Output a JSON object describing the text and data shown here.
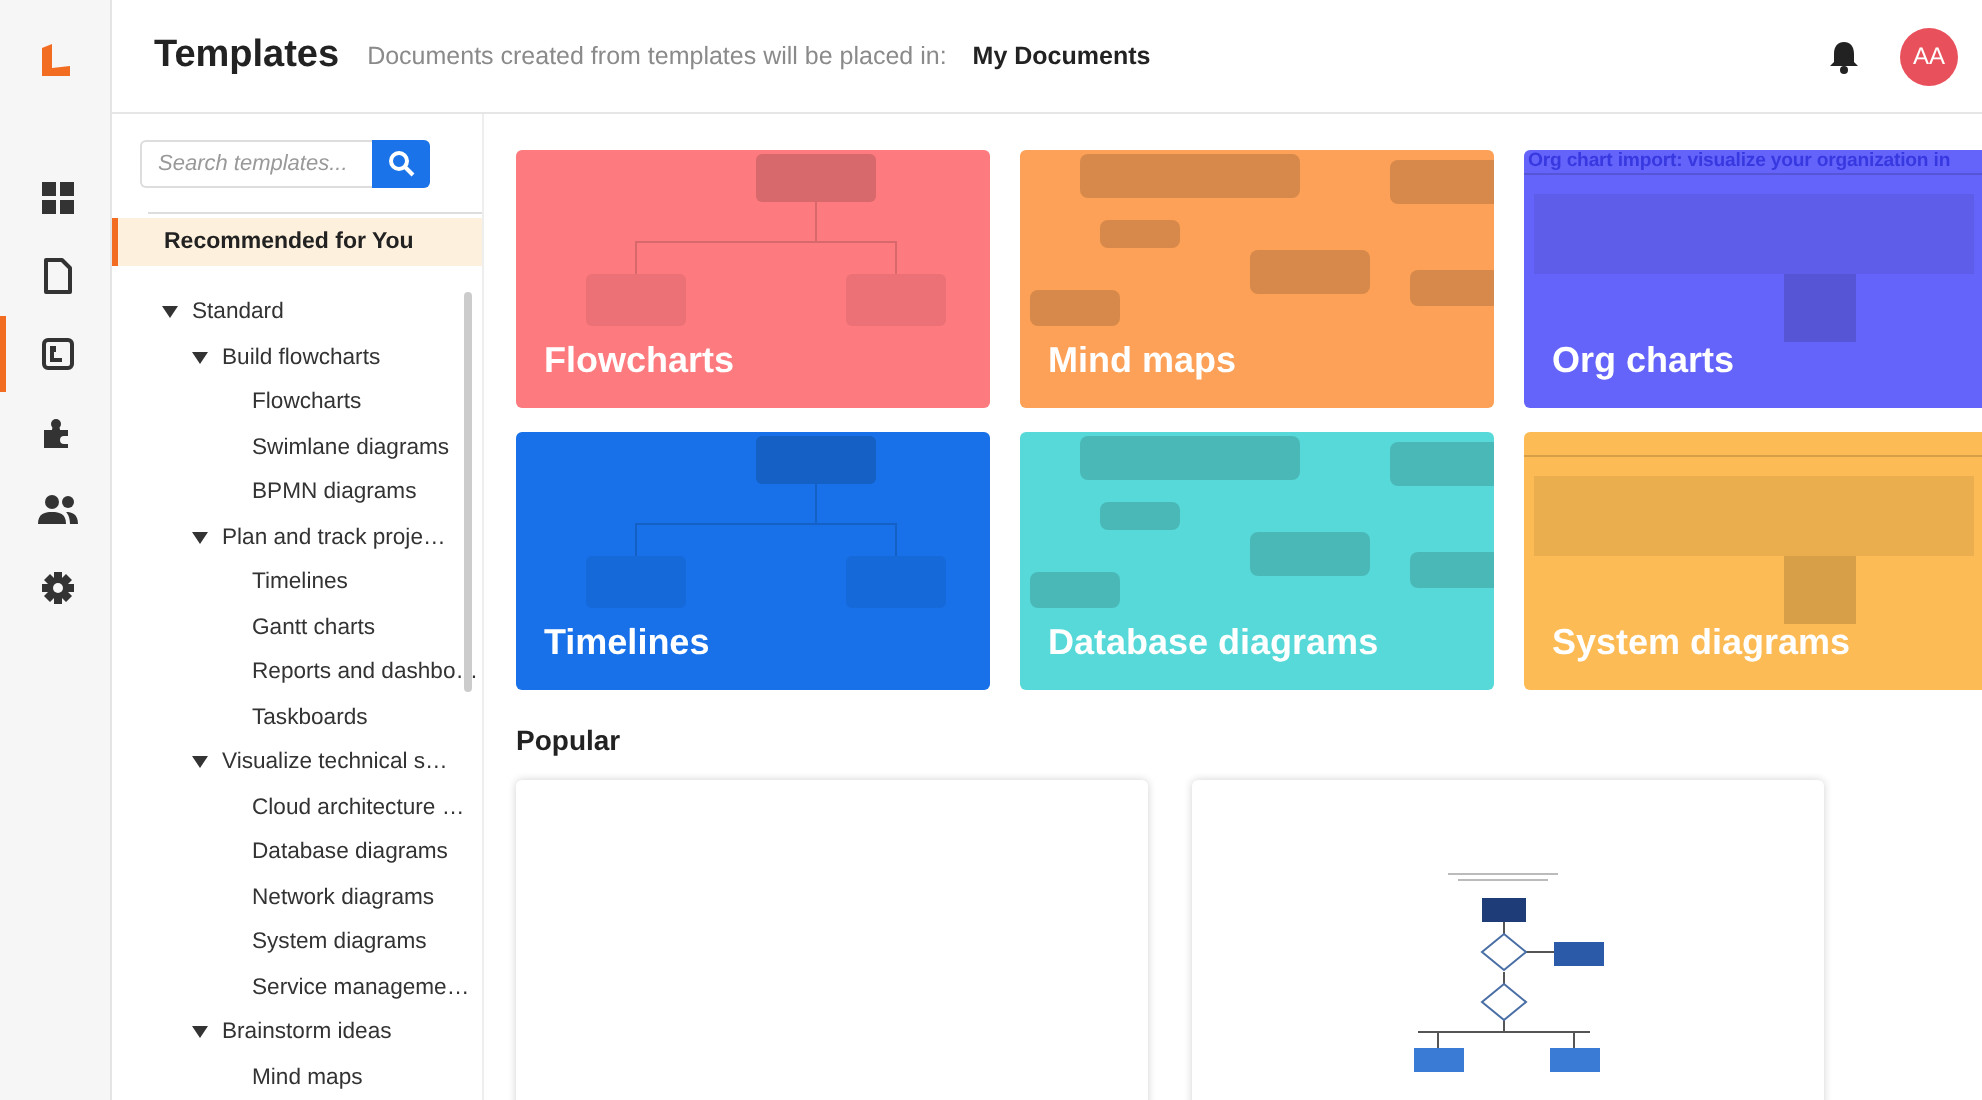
{
  "rail": {
    "items": [
      {
        "selected": false
      },
      {
        "selected": false
      },
      {
        "selected": true
      },
      {
        "selected": false
      },
      {
        "selected": false
      },
      {
        "selected": false
      }
    ]
  },
  "header": {
    "title": "Templates",
    "note": "Documents created from templates will be placed in:",
    "location": "My Documents",
    "avatar": "AA"
  },
  "sidebar": {
    "search": {
      "placeholder": "Search templates..."
    },
    "recommended": {
      "label": "Recommended for You",
      "selected": true
    },
    "tree": [
      {
        "label": "Standard",
        "expanded": true,
        "children": [
          {
            "label": "Build flowcharts",
            "expanded": true,
            "children": [
              {
                "label": "Flowcharts"
              },
              {
                "label": "Swimlane diagrams"
              },
              {
                "label": "BPMN diagrams"
              }
            ]
          },
          {
            "label": "Plan and track proje…",
            "expanded": true,
            "children": [
              {
                "label": "Timelines"
              },
              {
                "label": "Gantt charts"
              },
              {
                "label": "Reports and dashbo…"
              },
              {
                "label": "Taskboards"
              }
            ]
          },
          {
            "label": "Visualize technical s…",
            "expanded": true,
            "children": [
              {
                "label": "Cloud architecture …"
              },
              {
                "label": "Database diagrams"
              },
              {
                "label": "Network diagrams"
              },
              {
                "label": "System diagrams"
              },
              {
                "label": "Service manageme…"
              }
            ]
          },
          {
            "label": "Brainstorm ideas",
            "expanded": true,
            "children": [
              {
                "label": "Mind maps"
              }
            ]
          }
        ]
      }
    ]
  },
  "categories": [
    {
      "label": "Flowcharts",
      "color": "#fd7a7f"
    },
    {
      "label": "Mind maps",
      "color": "#fca157"
    },
    {
      "label": "Org charts",
      "color": "#6464fb",
      "thumbnail_heading": "Org chart import: visualize your organization in"
    },
    {
      "label": "Timelines",
      "color": "#1871e8"
    },
    {
      "label": "Database diagrams",
      "color": "#58d9d9"
    },
    {
      "label": "System diagrams",
      "color": "#fcbb55"
    }
  ],
  "popular": {
    "heading": "Popular",
    "cards": [
      {
        "kind": "blank"
      },
      {
        "kind": "flowchart"
      }
    ]
  }
}
